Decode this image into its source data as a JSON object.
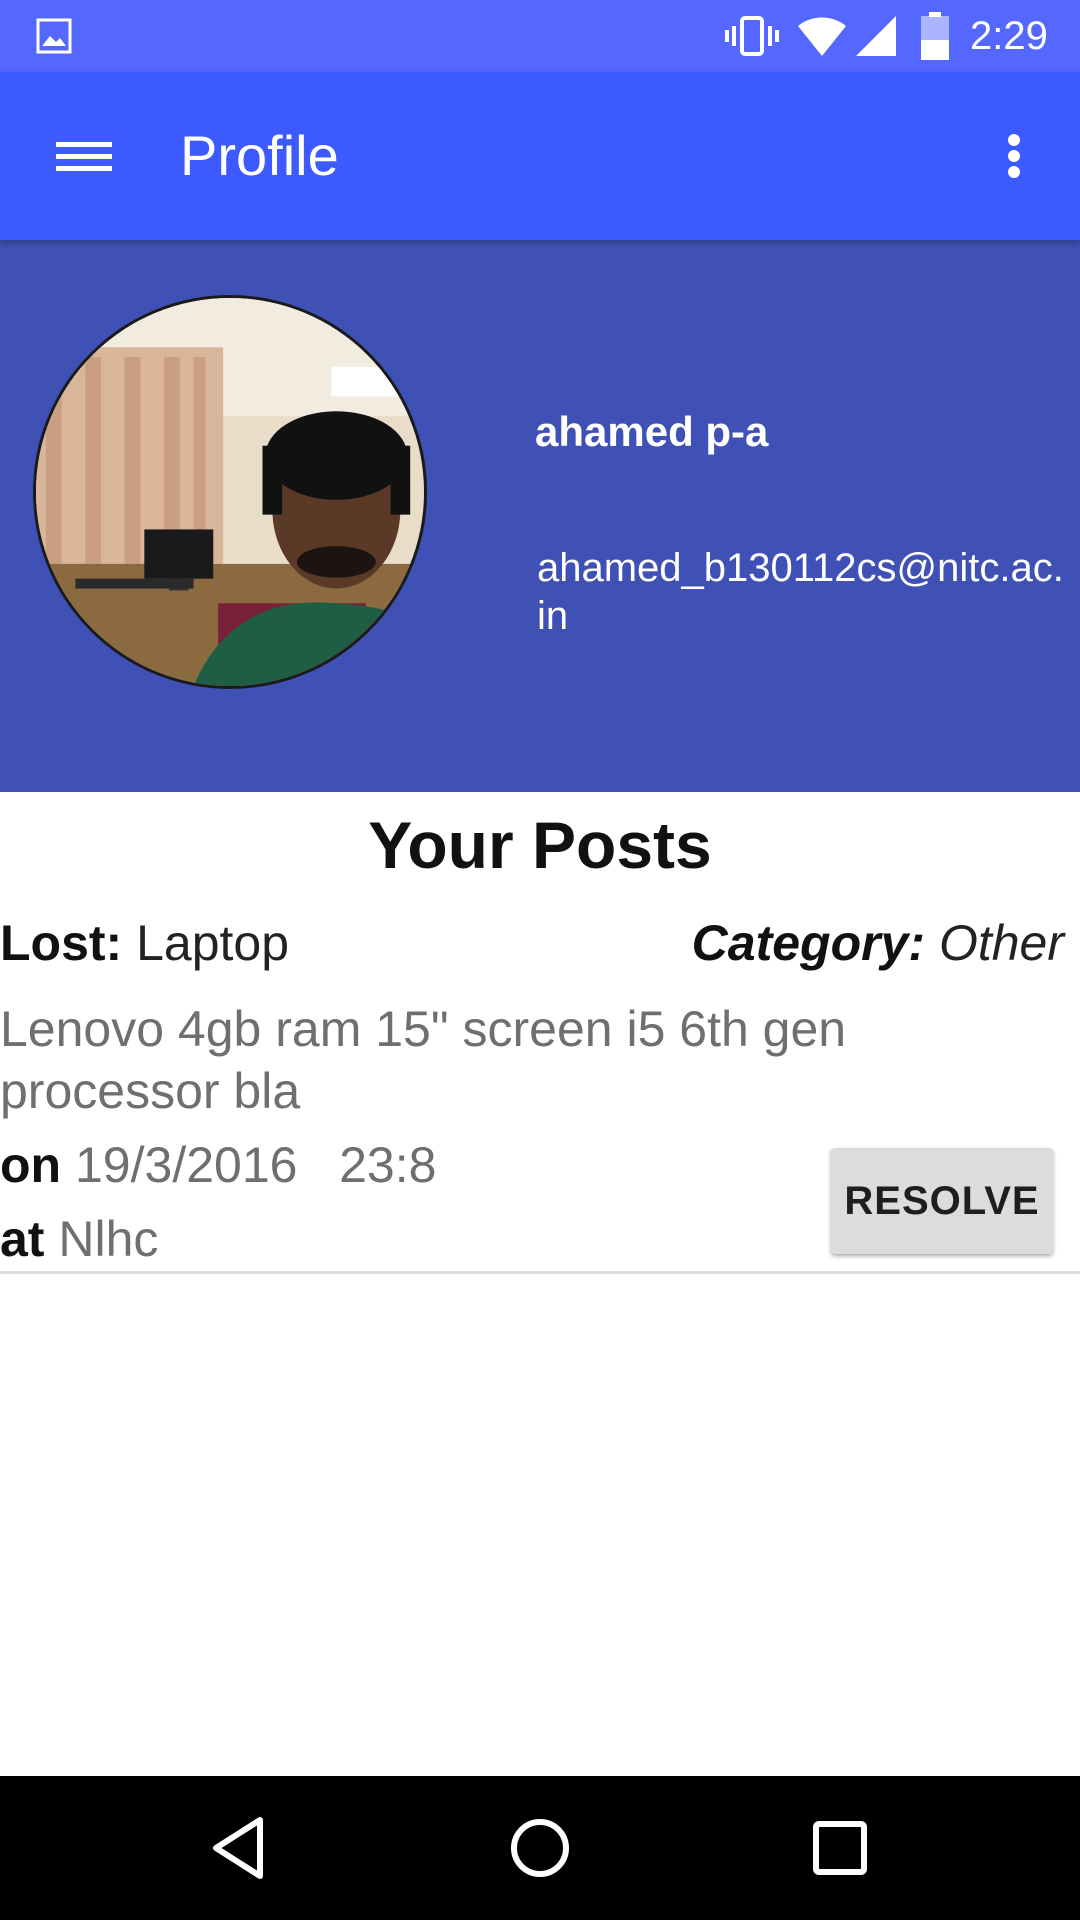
{
  "status_bar": {
    "time": "2:29",
    "icons": [
      "gallery-icon",
      "vibrate-icon",
      "wifi-icon",
      "signal-icon",
      "battery-icon"
    ],
    "color": "#5468ff"
  },
  "app_bar": {
    "title": "Profile",
    "menu_icon": "hamburger-menu-icon",
    "overflow_icon": "more-vert-icon",
    "color": "#3d5afe"
  },
  "profile": {
    "name": "ahamed p-a",
    "email": "ahamed_b130112cs@nitc.ac.in",
    "avatar": "profile-photo",
    "header_color": "#3f51b5"
  },
  "posts_section": {
    "title": "Your Posts",
    "posts": [
      {
        "type_label": "Lost:",
        "item": "Laptop",
        "category_label": "Category:",
        "category": "Other",
        "description": "Lenovo 4gb ram 15\" screen i5 6th gen processor bla",
        "date_label": "on",
        "date": "19/3/2016",
        "time": "23:8",
        "location_label": "at",
        "location": "Nlhc",
        "action_label": "RESOLVE"
      }
    ]
  },
  "nav_bar": {
    "icons": [
      "back-icon",
      "home-icon",
      "recents-icon"
    ]
  }
}
